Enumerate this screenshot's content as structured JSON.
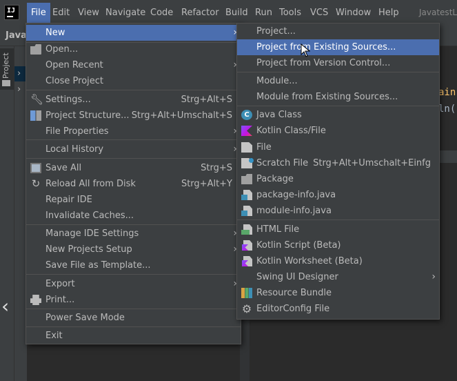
{
  "menubar": {
    "items": [
      "File",
      "Edit",
      "View",
      "Navigate",
      "Code",
      "Refactor",
      "Build",
      "Run",
      "Tools",
      "VCS",
      "Window",
      "Help"
    ],
    "window_title": "JavatestL"
  },
  "navbar": {
    "project_name": "Javat"
  },
  "sidebar": {
    "project_tab": "Project"
  },
  "editor": {
    "fragment1": "ain",
    "fragment2": "ln("
  },
  "file_menu": {
    "items": [
      {
        "label": "New",
        "shortcut": "",
        "submenu": true,
        "icon": ""
      },
      {
        "label": "Open...",
        "shortcut": "",
        "submenu": false,
        "icon": "folder-icon"
      },
      {
        "label": "Open Recent",
        "shortcut": "",
        "submenu": true,
        "icon": ""
      },
      {
        "label": "Close Project",
        "shortcut": "",
        "submenu": false,
        "icon": ""
      },
      {
        "label": "Settings...",
        "shortcut": "Strg+Alt+S",
        "submenu": false,
        "icon": "wrench-icon"
      },
      {
        "label": "Project Structure...",
        "shortcut": "Strg+Alt+Umschalt+S",
        "submenu": false,
        "icon": "project-structure-icon"
      },
      {
        "label": "File Properties",
        "shortcut": "",
        "submenu": true,
        "icon": ""
      },
      {
        "label": "Local History",
        "shortcut": "",
        "submenu": true,
        "icon": ""
      },
      {
        "label": "Save All",
        "shortcut": "Strg+S",
        "submenu": false,
        "icon": "save-icon"
      },
      {
        "label": "Reload All from Disk",
        "shortcut": "Strg+Alt+Y",
        "submenu": false,
        "icon": "reload-icon"
      },
      {
        "label": "Repair IDE",
        "shortcut": "",
        "submenu": false,
        "icon": ""
      },
      {
        "label": "Invalidate Caches...",
        "shortcut": "",
        "submenu": false,
        "icon": ""
      },
      {
        "label": "Manage IDE Settings",
        "shortcut": "",
        "submenu": true,
        "icon": ""
      },
      {
        "label": "New Projects Setup",
        "shortcut": "",
        "submenu": true,
        "icon": ""
      },
      {
        "label": "Save File as Template...",
        "shortcut": "",
        "submenu": false,
        "icon": ""
      },
      {
        "label": "Export",
        "shortcut": "",
        "submenu": true,
        "icon": ""
      },
      {
        "label": "Print...",
        "shortcut": "",
        "submenu": false,
        "icon": "print-icon"
      },
      {
        "label": "Power Save Mode",
        "shortcut": "",
        "submenu": false,
        "icon": ""
      },
      {
        "label": "Exit",
        "shortcut": "",
        "submenu": false,
        "icon": ""
      }
    ],
    "highlighted": "New"
  },
  "new_submenu": {
    "items": [
      {
        "label": "Project...",
        "shortcut": "",
        "submenu": false,
        "icon": ""
      },
      {
        "label": "Project from Existing Sources...",
        "shortcut": "",
        "submenu": false,
        "icon": ""
      },
      {
        "label": "Project from Version Control...",
        "shortcut": "",
        "submenu": false,
        "icon": ""
      },
      {
        "label": "Module...",
        "shortcut": "",
        "submenu": false,
        "icon": ""
      },
      {
        "label": "Module from Existing Sources...",
        "shortcut": "",
        "submenu": false,
        "icon": ""
      },
      {
        "label": "Java Class",
        "shortcut": "",
        "submenu": false,
        "icon": "java-class-icon"
      },
      {
        "label": "Kotlin Class/File",
        "shortcut": "",
        "submenu": false,
        "icon": "kotlin-icon"
      },
      {
        "label": "File",
        "shortcut": "",
        "submenu": false,
        "icon": "file-icon"
      },
      {
        "label": "Scratch File",
        "shortcut": "Strg+Alt+Umschalt+Einfg",
        "submenu": false,
        "icon": "scratch-file-icon"
      },
      {
        "label": "Package",
        "shortcut": "",
        "submenu": false,
        "icon": "package-icon"
      },
      {
        "label": "package-info.java",
        "shortcut": "",
        "submenu": false,
        "icon": "java-file-icon"
      },
      {
        "label": "module-info.java",
        "shortcut": "",
        "submenu": false,
        "icon": "java-file-icon"
      },
      {
        "label": "HTML File",
        "shortcut": "",
        "submenu": false,
        "icon": "html-file-icon"
      },
      {
        "label": "Kotlin Script (Beta)",
        "shortcut": "",
        "submenu": false,
        "icon": "kotlin-script-icon"
      },
      {
        "label": "Kotlin Worksheet (Beta)",
        "shortcut": "",
        "submenu": false,
        "icon": "kotlin-script-icon"
      },
      {
        "label": "Swing UI Designer",
        "shortcut": "",
        "submenu": true,
        "icon": ""
      },
      {
        "label": "Resource Bundle",
        "shortcut": "",
        "submenu": false,
        "icon": "resource-bundle-icon"
      },
      {
        "label": "EditorConfig File",
        "shortcut": "",
        "submenu": false,
        "icon": "gear-icon"
      }
    ],
    "highlighted": "Project from Existing Sources..."
  },
  "colors": {
    "highlight": "#4b6eaf",
    "menu_bg": "#3c3f41",
    "editor_bg": "#2b2b2b",
    "text": "#bbbbbb"
  }
}
